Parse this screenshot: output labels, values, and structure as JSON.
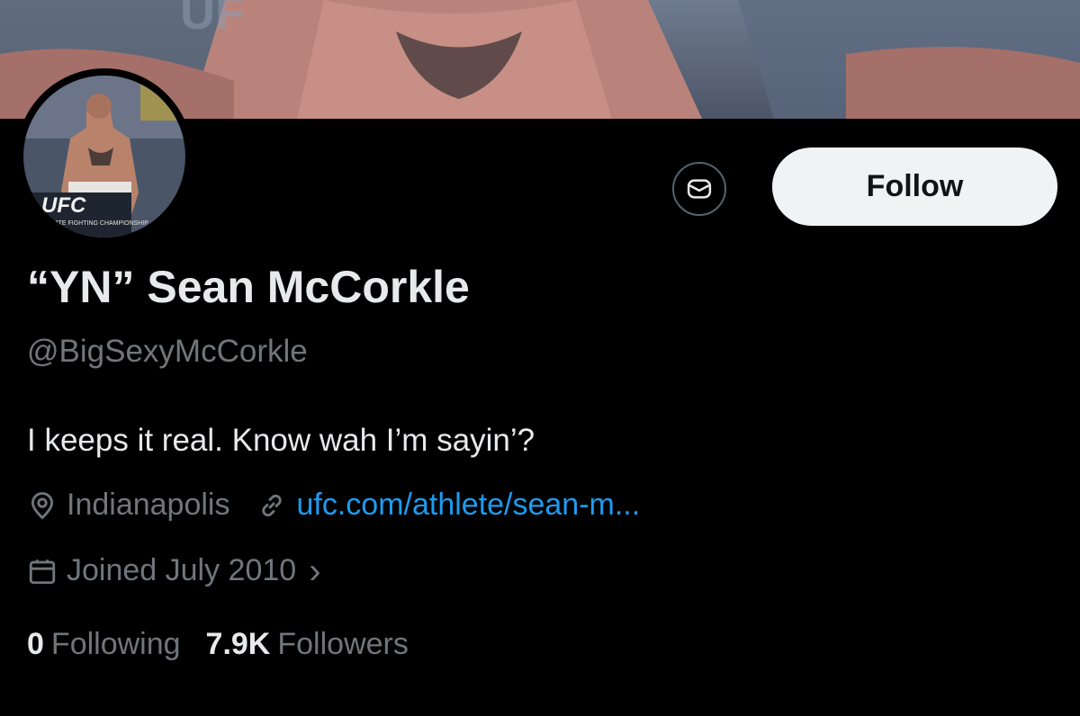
{
  "profile": {
    "display_name": "“YN” Sean McCorkle",
    "handle": "@BigSexyMcCorkle",
    "bio": "I keeps it real. Know wah I’m sayin’?",
    "location": "Indianapolis",
    "website": "ufc.com/athlete/sean-m...",
    "joined": "Joined July 2010",
    "joined_chevron": "›",
    "following_count": "0",
    "following_label": "Following",
    "followers_count": "7.9K",
    "followers_label": "Followers"
  },
  "actions": {
    "follow_label": "Follow",
    "message_icon": "envelope-icon"
  },
  "avatar": {
    "logo_text": "UFC",
    "logo_subtext": "ULTIMATE FIGHTING CHAMPIONSHIP"
  },
  "colors": {
    "background": "#000000",
    "primary_text": "#e7e9ea",
    "secondary_text": "#71767b",
    "link": "#1d9bf0",
    "follow_button_bg": "#eff3f4",
    "follow_button_text": "#0f1419",
    "border": "#536471"
  }
}
